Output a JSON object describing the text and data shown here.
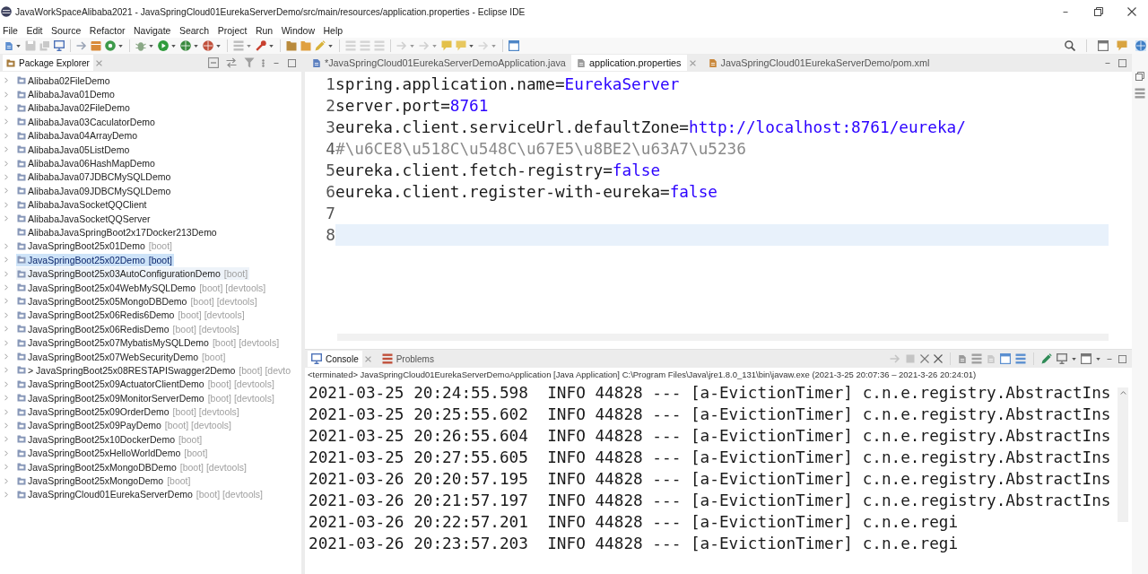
{
  "window": {
    "title": "JavaWorkSpaceAlibaba2021 - JavaSpringCloud01EurekaServerDemo/src/main/resources/application.properties - Eclipse IDE"
  },
  "menu": [
    "File",
    "Edit",
    "Source",
    "Refactor",
    "Navigate",
    "Search",
    "Project",
    "Run",
    "Window",
    "Help"
  ],
  "package_explorer": {
    "title": "Package Explorer",
    "items": [
      {
        "label": "Alibaba02FileDemo",
        "expandable": true,
        "selected": false,
        "hovered": false
      },
      {
        "label": "AlibabaJava01Demo",
        "expandable": true,
        "selected": false,
        "hovered": false
      },
      {
        "label": "AlibabaJava02FileDemo",
        "expandable": true,
        "selected": false,
        "hovered": false
      },
      {
        "label": "AlibabaJava03CaculatorDemo",
        "expandable": true,
        "selected": false,
        "hovered": false
      },
      {
        "label": "AlibabaJava04ArrayDemo",
        "expandable": true,
        "selected": false,
        "hovered": false
      },
      {
        "label": "AlibabaJava05ListDemo",
        "expandable": true,
        "selected": false,
        "hovered": false
      },
      {
        "label": "AlibabaJava06HashMapDemo",
        "expandable": true,
        "selected": false,
        "hovered": false
      },
      {
        "label": "AlibabaJava07JDBCMySQLDemo",
        "expandable": true,
        "selected": false,
        "hovered": false
      },
      {
        "label": "AlibabaJava09JDBCMySQLDemo",
        "expandable": true,
        "selected": false,
        "hovered": false
      },
      {
        "label": "AlibabaJavaSocketQQClient",
        "expandable": true,
        "selected": false,
        "hovered": false
      },
      {
        "label": "AlibabaJavaSocketQQServer",
        "expandable": true,
        "selected": false,
        "hovered": false
      },
      {
        "label": "AlibabaJavaSpringBoot2x17Docker213Demo",
        "expandable": false,
        "selected": false,
        "hovered": false
      },
      {
        "label": "JavaSpringBoot25x01Demo",
        "decorations": "[boot]",
        "expandable": true,
        "selected": false,
        "hovered": false
      },
      {
        "label": "JavaSpringBoot25x02Demo",
        "decorations": "[boot]",
        "expandable": true,
        "selected": true,
        "hovered": false
      },
      {
        "label": "JavaSpringBoot25x03AutoConfigurationDemo",
        "decorations": "[boot]",
        "expandable": true,
        "selected": false,
        "hovered": true
      },
      {
        "label": "JavaSpringBoot25x04WebMySQLDemo",
        "decorations": "[boot] [devtools]",
        "expandable": true,
        "selected": false,
        "hovered": false
      },
      {
        "label": "JavaSpringBoot25x05MongoDBDemo",
        "decorations": "[boot] [devtools]",
        "expandable": true,
        "selected": false,
        "hovered": false
      },
      {
        "label": "JavaSpringBoot25x06Redis6Demo",
        "decorations": "[boot] [devtools]",
        "expandable": true,
        "selected": false,
        "hovered": false
      },
      {
        "label": "JavaSpringBoot25x06RedisDemo",
        "decorations": "[boot] [devtools]",
        "expandable": true,
        "selected": false,
        "hovered": false
      },
      {
        "label": "JavaSpringBoot25x07MybatisMySQLDemo",
        "decorations": "[boot] [devtools]",
        "expandable": true,
        "selected": false,
        "hovered": false
      },
      {
        "label": "JavaSpringBoot25x07WebSecurityDemo",
        "decorations": "[boot]",
        "expandable": true,
        "selected": false,
        "hovered": false
      },
      {
        "label": "> JavaSpringBoot25x08RESTAPISwagger2Demo",
        "decorations": "[boot] [devto",
        "expandable": true,
        "selected": false,
        "hovered": false
      },
      {
        "label": "JavaSpringBoot25x09ActuatorClientDemo",
        "decorations": "[boot] [devtools]",
        "expandable": true,
        "selected": false,
        "hovered": false
      },
      {
        "label": "JavaSpringBoot25x09MonitorServerDemo",
        "decorations": "[boot] [devtools]",
        "expandable": true,
        "selected": false,
        "hovered": false
      },
      {
        "label": "JavaSpringBoot25x09OrderDemo",
        "decorations": "[boot] [devtools]",
        "expandable": true,
        "selected": false,
        "hovered": false
      },
      {
        "label": "JavaSpringBoot25x09PayDemo",
        "decorations": "[boot] [devtools]",
        "expandable": true,
        "selected": false,
        "hovered": false
      },
      {
        "label": "JavaSpringBoot25x10DockerDemo",
        "decorations": "[boot]",
        "expandable": true,
        "selected": false,
        "hovered": false
      },
      {
        "label": "JavaSpringBoot25xHelloWorldDemo",
        "decorations": "[boot]",
        "expandable": true,
        "selected": false,
        "hovered": false
      },
      {
        "label": "JavaSpringBoot25xMongoDBDemo",
        "decorations": "[boot] [devtools]",
        "expandable": true,
        "selected": false,
        "hovered": false
      },
      {
        "label": "JavaSpringBoot25xMongoDemo",
        "decorations": "[boot]",
        "expandable": true,
        "selected": false,
        "hovered": false
      },
      {
        "label": "JavaSpringCloud01EurekaServerDemo",
        "decorations": "[boot] [devtools]",
        "expandable": true,
        "selected": false,
        "hovered": false
      }
    ]
  },
  "editor": {
    "tabs": [
      {
        "label": "*JavaSpringCloud01EurekaServerDemoApplication.java",
        "kind": "java",
        "selected": false
      },
      {
        "label": "application.properties",
        "kind": "properties",
        "selected": true
      },
      {
        "label": "JavaSpringCloud01EurekaServerDemo/pom.xml",
        "kind": "xml",
        "selected": false
      }
    ],
    "lines": [
      {
        "number": "1",
        "current": false,
        "segments": [
          {
            "kind": "key",
            "text": "spring.application.name="
          },
          {
            "kind": "value",
            "text": "EurekaServer"
          }
        ]
      },
      {
        "number": "2",
        "current": false,
        "segments": [
          {
            "kind": "key",
            "text": "server.port="
          },
          {
            "kind": "value",
            "text": "8761"
          }
        ]
      },
      {
        "number": "3",
        "current": false,
        "segments": [
          {
            "kind": "key",
            "text": "eureka.client.serviceUrl.defaultZone="
          },
          {
            "kind": "value",
            "text": "http://localhost:8761/eureka/"
          }
        ]
      },
      {
        "number": "4",
        "current": false,
        "segments": [
          {
            "kind": "comment",
            "text": "#\\u6CE8\\u518C\\u548C\\u67E5\\u8BE2\\u63A7\\u5236"
          }
        ]
      },
      {
        "number": "5",
        "current": false,
        "segments": [
          {
            "kind": "key",
            "text": "eureka.client.fetch-registry="
          },
          {
            "kind": "value",
            "text": "false"
          }
        ]
      },
      {
        "number": "6",
        "current": false,
        "segments": [
          {
            "kind": "key",
            "text": "eureka.client.register-with-eureka="
          },
          {
            "kind": "value",
            "text": "false"
          }
        ]
      },
      {
        "number": "7",
        "current": false
      },
      {
        "number": "8",
        "current": true
      }
    ]
  },
  "console": {
    "tabs": [
      {
        "label": "Console",
        "kind": "console",
        "selected": true
      },
      {
        "label": "Problems",
        "kind": "problems",
        "selected": false
      }
    ],
    "status": "<terminated> JavaSpringCloud01EurekaServerDemoApplication [Java Application] C:\\Program Files\\Java\\jre1.8.0_131\\bin\\javaw.exe  (2021-3-25 20:07:36 – 2021-3-26 20:24:01)",
    "lines": [
      "2021-03-25 20:24:55.598  INFO 44828 --- [a-EvictionTimer] c.n.e.registry.AbstractIns",
      "2021-03-25 20:25:55.602  INFO 44828 --- [a-EvictionTimer] c.n.e.registry.AbstractIns",
      "2021-03-25 20:26:55.604  INFO 44828 --- [a-EvictionTimer] c.n.e.registry.AbstractIns",
      "2021-03-25 20:27:55.605  INFO 44828 --- [a-EvictionTimer] c.n.e.registry.AbstractIns",
      "2021-03-26 20:20:57.195  INFO 44828 --- [a-EvictionTimer] c.n.e.registry.AbstractIns",
      "2021-03-26 20:21:57.197  INFO 44828 --- [a-EvictionTimer] c.n.e.registry.AbstractIns",
      "2021-03-26 20:22:57.201  INFO 44828 --- [a-EvictionTimer] c.n.e.regi",
      "2021-03-26 20:23:57.203  INFO 44828 --- [a-EvictionTimer] c.n.e.regi"
    ]
  }
}
